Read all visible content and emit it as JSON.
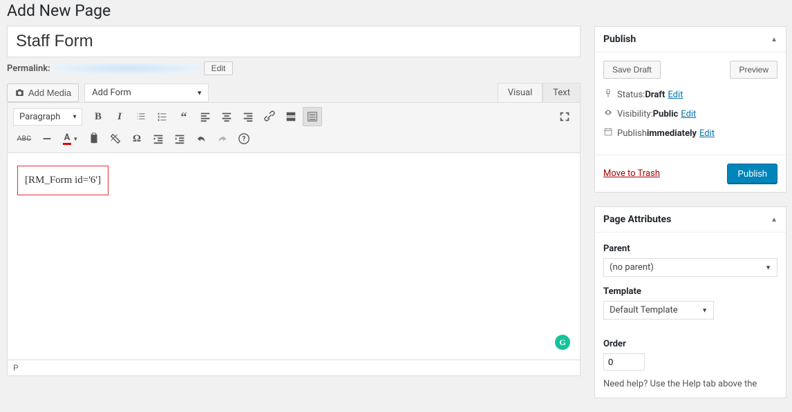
{
  "header": {
    "title": "Add New Page"
  },
  "title_input": {
    "value": "Staff Form"
  },
  "permalink": {
    "label": "Permalink:",
    "edit": "Edit"
  },
  "media_button": "Add Media",
  "add_form_select": "Add Form",
  "editor_tabs": {
    "visual": "Visual",
    "text": "Text"
  },
  "toolbar": {
    "paragraph": "Paragraph"
  },
  "content": {
    "shortcode": "[RM_Form id='6']"
  },
  "status_bar": "P",
  "publish_panel": {
    "title": "Publish",
    "save_draft": "Save Draft",
    "preview": "Preview",
    "status_label": "Status: ",
    "status_value": "Draft",
    "visibility_label": "Visibility: ",
    "visibility_value": "Public",
    "publish_label": "Publish ",
    "publish_value": "immediately",
    "edit": "Edit",
    "trash": "Move to Trash",
    "publish_btn": "Publish"
  },
  "attributes_panel": {
    "title": "Page Attributes",
    "parent_label": "Parent",
    "parent_value": "(no parent)",
    "template_label": "Template",
    "template_value": "Default Template",
    "order_label": "Order",
    "order_value": "0",
    "help": "Need help? Use the Help tab above the"
  },
  "grammarly": "G"
}
